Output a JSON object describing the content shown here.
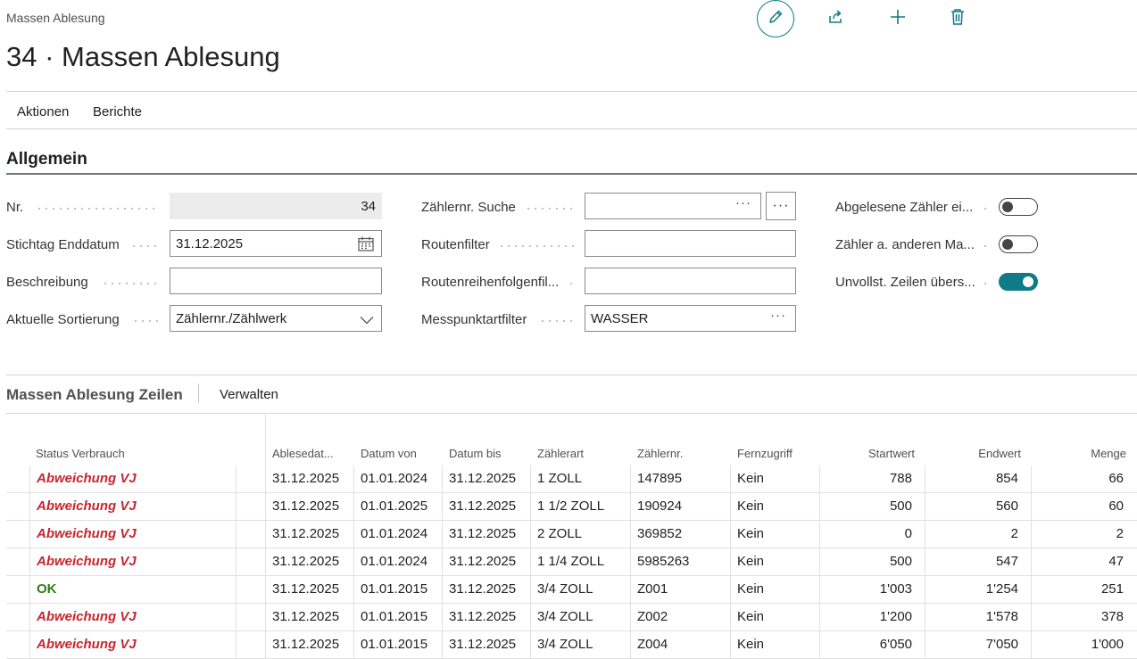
{
  "breadcrumb": "Massen Ablesung",
  "page_title": "34 · Massen Ablesung",
  "top_actions": {
    "edit_icon": "pencil-icon",
    "share_icon": "share-icon",
    "add_icon": "plus-icon",
    "delete_icon": "trash-icon",
    "accent_color": "#0f7b86"
  },
  "menu": {
    "actions": "Aktionen",
    "reports": "Berichte"
  },
  "section": {
    "title": "Allgemein",
    "col1": {
      "nr_label": "Nr.",
      "nr_value": "34",
      "stichtag_label": "Stichtag Enddatum",
      "stichtag_value": "31.12.2025",
      "beschreibung_label": "Beschreibung",
      "beschreibung_value": "",
      "sortierung_label": "Aktuelle Sortierung",
      "sortierung_value": "Zählernr./Zählwerk"
    },
    "col2": {
      "zaehler_suche_label": "Zählernr. Suche",
      "zaehler_suche_value": "",
      "routenfilter_label": "Routenfilter",
      "routenfilter_value": "",
      "routenreihenfolge_label": "Routenreihenfolgenfil...",
      "routenreihenfolge_value": "",
      "messpunkt_label": "Messpunktartfilter",
      "messpunkt_value": "WASSER"
    },
    "col3": {
      "abgelesene_label": "Abgelesene Zähler ei...",
      "abgelesene_on": false,
      "andere_label": "Zähler a. anderen Ma...",
      "andere_on": false,
      "unvollst_label": "Unvollst. Zeilen übers...",
      "unvollst_on": true
    }
  },
  "lines": {
    "title": "Massen Ablesung Zeilen",
    "manage": "Verwalten",
    "columns": [
      "Status Verbrauch",
      "Ablesedat...",
      "Datum von",
      "Datum bis",
      "Zählerart",
      "Zählernr.",
      "Fernzugriff",
      "Startwert",
      "Endwert",
      "Menge"
    ],
    "rows": [
      {
        "status": "Abweichung VJ",
        "ok": false,
        "ablesedatum": "31.12.2025",
        "von": "01.01.2024",
        "bis": "31.12.2025",
        "art": "1 ZOLL",
        "nr": "147895",
        "fern": "Kein",
        "start": "788",
        "end": "854",
        "menge": "66"
      },
      {
        "status": "Abweichung VJ",
        "ok": false,
        "ablesedatum": "31.12.2025",
        "von": "01.01.2025",
        "bis": "31.12.2025",
        "art": "1 1/2 ZOLL",
        "nr": "190924",
        "fern": "Kein",
        "start": "500",
        "end": "560",
        "menge": "60"
      },
      {
        "status": "Abweichung VJ",
        "ok": false,
        "ablesedatum": "31.12.2025",
        "von": "01.01.2024",
        "bis": "31.12.2025",
        "art": "2 ZOLL",
        "nr": "369852",
        "fern": "Kein",
        "start": "0",
        "end": "2",
        "menge": "2"
      },
      {
        "status": "Abweichung VJ",
        "ok": false,
        "ablesedatum": "31.12.2025",
        "von": "01.01.2024",
        "bis": "31.12.2025",
        "art": "1 1/4 ZOLL",
        "nr": "5985263",
        "fern": "Kein",
        "start": "500",
        "end": "547",
        "menge": "47"
      },
      {
        "status": "OK",
        "ok": true,
        "ablesedatum": "31.12.2025",
        "von": "01.01.2015",
        "bis": "31.12.2025",
        "art": "3/4 ZOLL",
        "nr": "Z001",
        "fern": "Kein",
        "start": "1'003",
        "end": "1'254",
        "menge": "251"
      },
      {
        "status": "Abweichung VJ",
        "ok": false,
        "ablesedatum": "31.12.2025",
        "von": "01.01.2015",
        "bis": "31.12.2025",
        "art": "3/4 ZOLL",
        "nr": "Z002",
        "fern": "Kein",
        "start": "1'200",
        "end": "1'578",
        "menge": "378"
      },
      {
        "status": "Abweichung VJ",
        "ok": false,
        "ablesedatum": "31.12.2025",
        "von": "01.01.2015",
        "bis": "31.12.2025",
        "art": "3/4 ZOLL",
        "nr": "Z004",
        "fern": "Kein",
        "start": "6'050",
        "end": "7'050",
        "menge": "1'000"
      }
    ]
  }
}
